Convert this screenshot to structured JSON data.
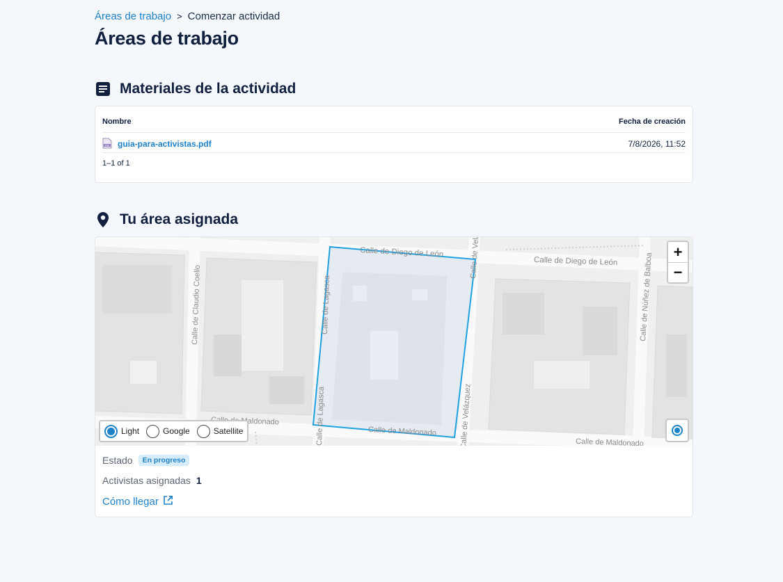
{
  "breadcrumb": {
    "parent": "Áreas de trabajo",
    "separator": ">",
    "current": "Comenzar actividad"
  },
  "page_title": "Áreas de trabajo",
  "materials": {
    "title": "Materiales de la actividad",
    "icon": "document-icon",
    "columns": {
      "name": "Nombre",
      "created": "Fecha de creación"
    },
    "rows": [
      {
        "name": "guia-para-activistas.pdf",
        "created": "7/8/2026, 11:52",
        "icon": "pdf-file-icon"
      }
    ],
    "pagination": "1–1 of 1"
  },
  "area": {
    "title": "Tu área asignada",
    "icon": "location-pin-icon",
    "map": {
      "zoom_in": "+",
      "zoom_out": "−",
      "layers": [
        {
          "label": "Light",
          "selected": true
        },
        {
          "label": "Google",
          "selected": false
        },
        {
          "label": "Satellite",
          "selected": false
        }
      ],
      "street_labels": {
        "diego_leon_1": "Calle de Diego de León",
        "diego_leon_2": "Calle de Diego de León",
        "claudio_coello": "Calle de Claudio Coello",
        "lagasca_1": "Calle de Lagasca",
        "lagasca_2": "Calle de Lagasca",
        "nunez_balboa": "Calle de Núñez de Balboa",
        "maldonado_1": "Calle de Maldonado",
        "maldonado_2": "Calle de Maldonado",
        "maldonado_3": "Calle de Maldonado",
        "velazquez_top": "Calle de Velázquez",
        "velazquez_bottom": "Calle de Velázquez"
      },
      "colors": {
        "area_outline": "#1ea1e0",
        "area_fill": "#e6ebf2"
      }
    },
    "status_label": "Estado",
    "status_value": "En progreso",
    "activists_label": "Activistas asignadas",
    "activists_count": "1",
    "directions_label": "Cómo llegar",
    "directions_icon": "external-link-icon"
  },
  "colors": {
    "accent": "#1e82c9",
    "title": "#0f1f3d",
    "background": "#f4f7fb"
  }
}
